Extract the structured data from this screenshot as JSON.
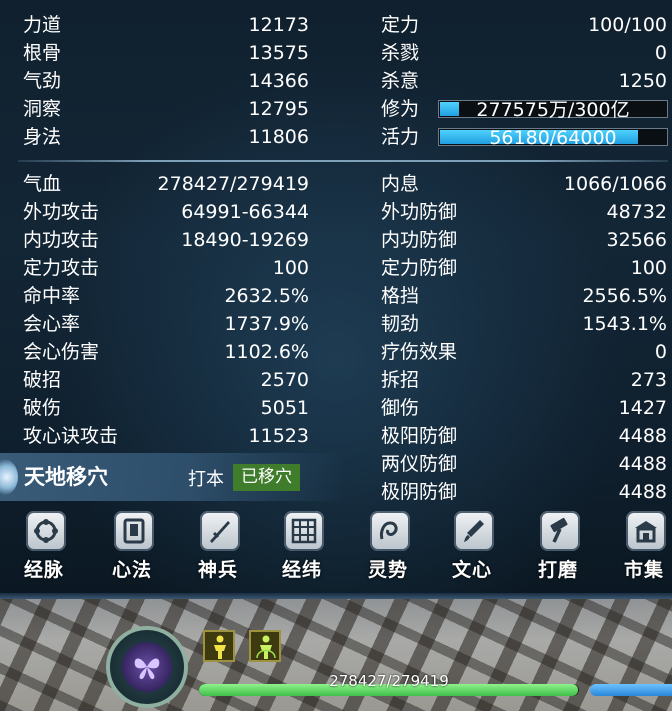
{
  "base_stats": {
    "left": [
      {
        "label": "力道",
        "value": "12173"
      },
      {
        "label": "根骨",
        "value": "13575"
      },
      {
        "label": "气劲",
        "value": "14366"
      },
      {
        "label": "洞察",
        "value": "12795"
      },
      {
        "label": "身法",
        "value": "11806"
      }
    ],
    "right": [
      {
        "label": "定力",
        "value": "100/100"
      },
      {
        "label": "杀戮",
        "value": "0"
      },
      {
        "label": "杀意",
        "value": "1250"
      }
    ],
    "cultivation": {
      "label": "修为",
      "text": "277575万/300亿",
      "fill_fraction": 0.093
    },
    "vitality": {
      "label": "活力",
      "text": "56180/64000",
      "fill_fraction": 0.878
    }
  },
  "combat_stats": {
    "left": [
      {
        "label": "气血",
        "value": "278427/279419"
      },
      {
        "label": "外功攻击",
        "value": "64991-66344"
      },
      {
        "label": "内功攻击",
        "value": "18490-19269"
      },
      {
        "label": "定力攻击",
        "value": "100"
      },
      {
        "label": "命中率",
        "value": "2632.5%"
      },
      {
        "label": "会心率",
        "value": "1737.9%"
      },
      {
        "label": "会心伤害",
        "value": "1102.6%"
      },
      {
        "label": "破招",
        "value": "2570"
      },
      {
        "label": "破伤",
        "value": "5051"
      },
      {
        "label": "攻心诀攻击",
        "value": "11523"
      }
    ],
    "right": [
      {
        "label": "内息",
        "value": "1066/1066"
      },
      {
        "label": "外功防御",
        "value": "48732"
      },
      {
        "label": "内功防御",
        "value": "32566"
      },
      {
        "label": "定力防御",
        "value": "100"
      },
      {
        "label": "格挡",
        "value": "2556.5%"
      },
      {
        "label": "韧劲",
        "value": "1543.1%"
      },
      {
        "label": "疗伤效果",
        "value": "0"
      },
      {
        "label": "拆招",
        "value": "273"
      },
      {
        "label": "御伤",
        "value": "1427"
      },
      {
        "label": "极阳防御",
        "value": "4488"
      },
      {
        "label": "两仪防御",
        "value": "4488"
      },
      {
        "label": "极阴防御",
        "value": "4488"
      }
    ]
  },
  "acupoint": {
    "title": "天地移穴",
    "tag_label": "打本",
    "status": "已移穴"
  },
  "menu": [
    {
      "label": "经脉",
      "icon": "meridian-icon"
    },
    {
      "label": "心法",
      "icon": "book-icon"
    },
    {
      "label": "神兵",
      "icon": "sword-icon"
    },
    {
      "label": "经纬",
      "icon": "grid-icon"
    },
    {
      "label": "灵势",
      "icon": "spirit-hand-icon"
    },
    {
      "label": "文心",
      "icon": "brush-icon"
    },
    {
      "label": "打磨",
      "icon": "hammer-icon"
    },
    {
      "label": "市集",
      "icon": "market-icon"
    }
  ],
  "hud": {
    "hp_text": "278427/279419",
    "hp_fraction": 0.9965,
    "portrait_icon": "butterfly-icon",
    "buffs": [
      "buff-figure-icon",
      "buff-aura-icon"
    ]
  },
  "colors": {
    "bar_blue": "#2ab4f0",
    "status_green": "#3f7d2c",
    "hp_green": "#5fd35f"
  }
}
